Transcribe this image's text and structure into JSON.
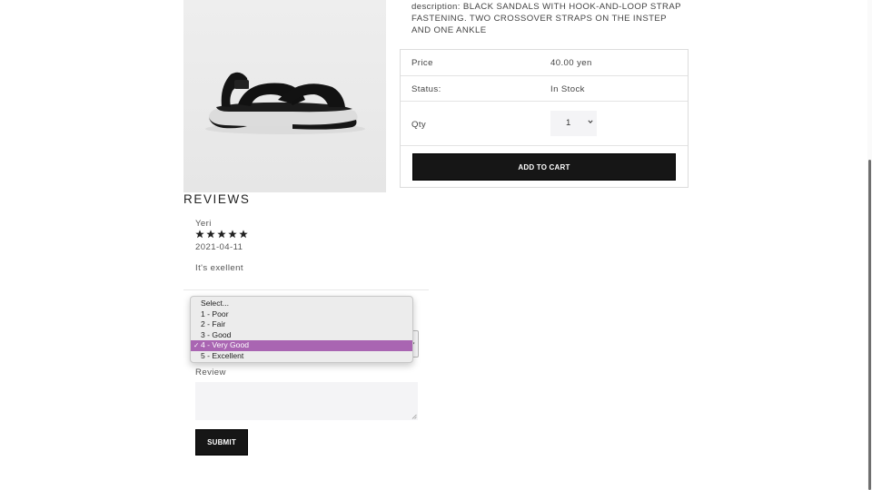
{
  "product": {
    "image_alt": "Black sandals",
    "description": "description: BLACK SANDALS WITH HOOK-AND-LOOP STRAP FASTENING. TWO CROSSOVER STRAPS ON THE INSTEP AND ONE ANKLE"
  },
  "details": {
    "price_label": "Price",
    "price_value": "40.00 yen",
    "status_label": "Status:",
    "status_value": "In Stock",
    "qty_label": "Qty",
    "qty_value": "1",
    "add_to_cart_label": "ADD TO CART"
  },
  "reviews": {
    "title": "REVIEWS",
    "items": [
      {
        "author": "Yeri",
        "rating": 5,
        "date": "2021-04-11",
        "text": "It's exellent"
      }
    ]
  },
  "review_form": {
    "rating_options": [
      "Select...",
      "1 - Poor",
      "2 - Fair",
      "3 - Good",
      "4 - Very Good",
      "5 - Excellent"
    ],
    "rating_selected": "4 - Very Good",
    "review_label": "Review",
    "submit_label": "SUBMIT"
  },
  "colors": {
    "button_bg": "#161616",
    "highlight": "#a965b2"
  }
}
